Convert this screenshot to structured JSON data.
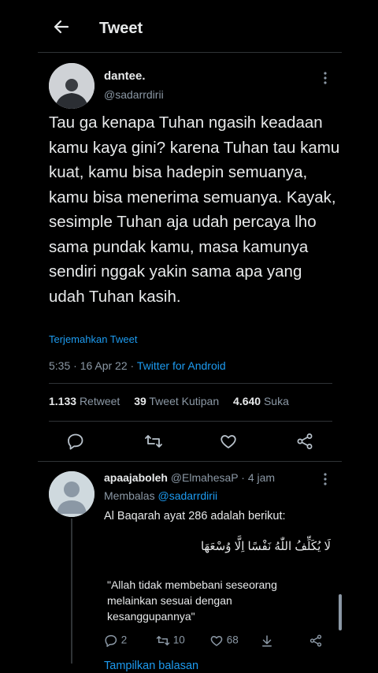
{
  "header": {
    "title": "Tweet"
  },
  "tweet": {
    "name": "dantee.",
    "handle": "@sadarrdirii",
    "text": "Tau ga kenapa Tuhan ngasih keadaan kamu kaya gini? karena Tuhan tau kamu kuat, kamu bisa hadepin semuanya, kamu bisa menerima semuanya. Kayak, sesimple Tuhan aja udah percaya lho sama pundak kamu, masa kamunya sendiri nggak yakin sama apa yang udah Tuhan kasih.",
    "translate": "Terjemahkan Tweet",
    "time": "5:35 · 16 Apr 22 · ",
    "source": "Twitter for Android",
    "stats": {
      "retweets": "1.133",
      "retweets_label": "Retweet",
      "quotes": "39",
      "quotes_label": "Tweet Kutipan",
      "likes": "4.640",
      "likes_label": "Suka"
    },
    "actions": [
      "reply-icon",
      "retweet-icon",
      "like-icon",
      "share-icon"
    ]
  },
  "reply": {
    "name": "apaajaboleh",
    "handle": "@ElmahesaP",
    "time": "· 4 jam",
    "replying_label": "Membalas",
    "replying_to": "@sadarrdirii",
    "text": "Al Baqarah ayat 286 adalah berikut:",
    "arabic": "لَا يُكَلِّفُ اللّٰهُ نَفْسًا اِلَّا وُسْعَهَا",
    "quote": "\"Allah tidak membebani seseorang melainkan sesuai dengan kesanggupannya\"",
    "replies": "2",
    "retweets": "10",
    "likes": "68",
    "show_replies": "Tampilkan balasan"
  },
  "colors": {
    "accent": "#1d9bf0",
    "muted": "#8b98a5",
    "background": "#000000"
  }
}
